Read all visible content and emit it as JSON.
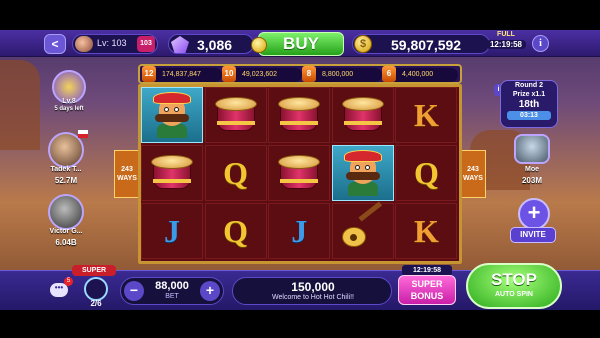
{
  "top_hud": {
    "level": "Lv: 103",
    "level_badge": "103",
    "gems": "3,086",
    "buy_label": "BUY",
    "coins": "59,807,592",
    "full_label": "FULL",
    "full_timer": "12:19:58",
    "info_label": "i"
  },
  "left_panel": {
    "player_level": "Lv.8",
    "player_days": "5 days left",
    "friends": [
      {
        "name": "Tadek T...",
        "value": "52.7M"
      },
      {
        "name": "Victor G...",
        "value": "6.04B"
      }
    ]
  },
  "jackpots": [
    {
      "multiplier": "12",
      "value": "174,837,847"
    },
    {
      "multiplier": "10",
      "value": "49,023,602"
    },
    {
      "multiplier": "8",
      "value": "8,800,000"
    },
    {
      "multiplier": "6",
      "value": "4,400,000"
    }
  ],
  "ways": {
    "left": "243\nWAYS",
    "right": "243\nWAYS"
  },
  "reels": {
    "rows": [
      [
        "mascot",
        "drum",
        "drum",
        "drum",
        "K"
      ],
      [
        "drum",
        "Q",
        "drum",
        "mascot",
        "Q"
      ],
      [
        "J",
        "Q",
        "J",
        "guitar",
        "K"
      ]
    ]
  },
  "tournament": {
    "round": "Round 2",
    "prize": "Prize x1.1",
    "rank": "18th",
    "time": "03:13"
  },
  "right_player": {
    "name": "Moe",
    "value": "203M"
  },
  "invite_label": "INVITE",
  "bottom_bar": {
    "chat_badge": "5",
    "super_label": "SUPER",
    "super_count": "2/6",
    "bet_value": "88,000",
    "bet_label": "BET",
    "win_value": "150,000",
    "message": "Welcome to Hot Hot Chili!!",
    "bonus_timer": "12:19:58",
    "bonus_label_1": "SUPER",
    "bonus_label_2": "BONUS",
    "stop_label": "STOP",
    "auto_spin_label": "AUTO SPIN"
  }
}
